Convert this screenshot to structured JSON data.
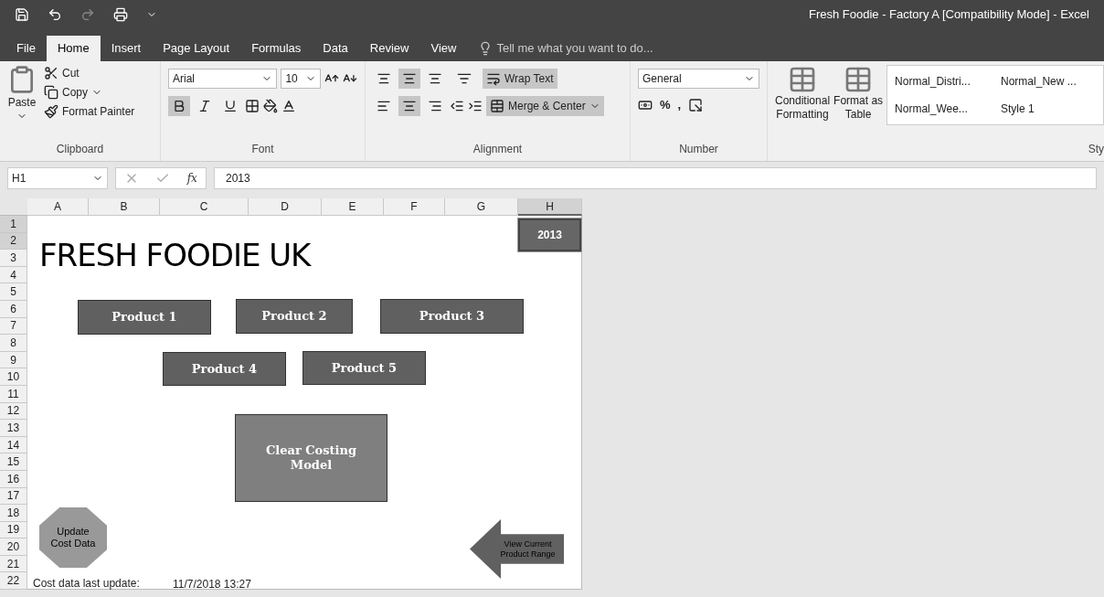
{
  "window": {
    "title": "Fresh Foodie - Factory A  [Compatibility Mode] - Excel"
  },
  "tabs": [
    {
      "label": "File",
      "selected": false
    },
    {
      "label": "Home",
      "selected": true
    },
    {
      "label": "Insert",
      "selected": false
    },
    {
      "label": "Page Layout",
      "selected": false
    },
    {
      "label": "Formulas",
      "selected": false
    },
    {
      "label": "Data",
      "selected": false
    },
    {
      "label": "Review",
      "selected": false
    },
    {
      "label": "View",
      "selected": false
    }
  ],
  "tell_me": {
    "placeholder": "Tell me what you want to do..."
  },
  "ribbon": {
    "clipboard": {
      "paste": "Paste",
      "cut": "Cut",
      "copy": "Copy",
      "format_painter": "Format Painter",
      "label": "Clipboard"
    },
    "font": {
      "name": "Arial",
      "size": "10",
      "bold": true,
      "italic": false,
      "underline": false,
      "label": "Font"
    },
    "alignment": {
      "top": false,
      "middle": true,
      "bottom": false,
      "left": false,
      "center": true,
      "right": false,
      "wrap_text": {
        "label": "Wrap Text",
        "on": true
      },
      "merge": {
        "label": "Merge & Center",
        "on": true
      },
      "label": "Alignment"
    },
    "number": {
      "format": "General",
      "percent": "%",
      "comma": ",",
      "label": "Number"
    },
    "styles": {
      "conditional": [
        "Conditional",
        "Formatting"
      ],
      "format_table": [
        "Format as",
        "Table"
      ],
      "gallery": [
        "Normal_Distri...",
        "Normal_New ...",
        "Normal_Wee...",
        "Style 1"
      ],
      "label": "Sty"
    }
  },
  "formula_bar": {
    "name_box": "H1",
    "fx": "fx",
    "value": "2013"
  },
  "columns": [
    {
      "label": "A",
      "selected": false
    },
    {
      "label": "B",
      "selected": false
    },
    {
      "label": "C",
      "selected": false
    },
    {
      "label": "D",
      "selected": false
    },
    {
      "label": "E",
      "selected": false
    },
    {
      "label": "F",
      "selected": false
    },
    {
      "label": "G",
      "selected": false
    },
    {
      "label": "H",
      "selected": true
    }
  ],
  "rows": [
    {
      "label": "1",
      "selected": true
    },
    {
      "label": "2",
      "selected": true
    },
    {
      "label": "3",
      "selected": false
    },
    {
      "label": "4",
      "selected": false
    },
    {
      "label": "5",
      "selected": false
    },
    {
      "label": "6",
      "selected": false
    },
    {
      "label": "7",
      "selected": false
    },
    {
      "label": "8",
      "selected": false
    },
    {
      "label": "9",
      "selected": false
    },
    {
      "label": "10",
      "selected": false
    },
    {
      "label": "11",
      "selected": false
    },
    {
      "label": "12",
      "selected": false
    },
    {
      "label": "13",
      "selected": false
    },
    {
      "label": "14",
      "selected": false
    },
    {
      "label": "15",
      "selected": false
    },
    {
      "label": "16",
      "selected": false
    },
    {
      "label": "17",
      "selected": false
    },
    {
      "label": "18",
      "selected": false
    },
    {
      "label": "19",
      "selected": false
    },
    {
      "label": "20",
      "selected": false
    },
    {
      "label": "21",
      "selected": false
    },
    {
      "label": "22",
      "selected": false
    }
  ],
  "sheet": [
    {
      "kind": "cell",
      "text": "2013",
      "selected": true
    },
    {
      "kind": "heading",
      "text": "FRESH FOODIE UK"
    },
    {
      "kind": "button",
      "text": "Product 1"
    },
    {
      "kind": "button",
      "text": "Product 2"
    },
    {
      "kind": "button",
      "text": "Product 3"
    },
    {
      "kind": "button",
      "text": "Product 4"
    },
    {
      "kind": "button",
      "text": "Product 5"
    },
    {
      "kind": "big_button",
      "text": "Clear Costing Model"
    },
    {
      "kind": "octagon",
      "text": "Update Cost Data"
    },
    {
      "kind": "arrow",
      "text": "View Current Product Range"
    },
    {
      "kind": "text",
      "text": "Cost data last update:"
    },
    {
      "kind": "text",
      "text": "11/7/2018 13:27"
    }
  ]
}
